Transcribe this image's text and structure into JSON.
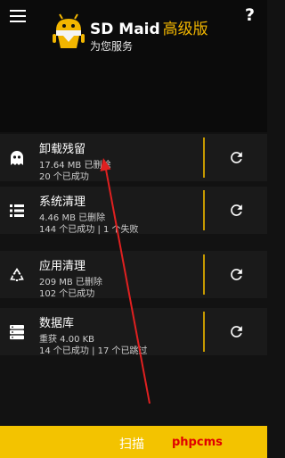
{
  "header": {
    "title": "SD Maid",
    "title_suffix": "高级版",
    "subtitle": "为您服务",
    "menu_icon": "hamburger-menu-icon",
    "help_label": "?",
    "logo_icon": "sd-maid-robot-logo",
    "accent_color": "#f2b600"
  },
  "tools": [
    {
      "name": "卸载残留",
      "line1": "17.64 MB 已删除",
      "line2": "20 个已成功",
      "icon": "ghost-icon"
    },
    {
      "name": "系统清理",
      "line1": "4.46 MB 已删除",
      "line2": "144 个已成功 | 1 个失败",
      "icon": "list-icon"
    },
    {
      "name": "应用清理",
      "line1": "209 MB 已删除",
      "line2": "102 个已成功",
      "icon": "recycle-icon"
    },
    {
      "name": "数据库",
      "line1": "重获 4.00 KB",
      "line2": "14 个已成功 | 17 个已跳过",
      "icon": "database-icon"
    }
  ],
  "footer": {
    "scan_label": "扫描",
    "watermark": "phpcms",
    "bar_color": "#f3c300"
  },
  "annotation": {
    "color": "#e02020"
  }
}
